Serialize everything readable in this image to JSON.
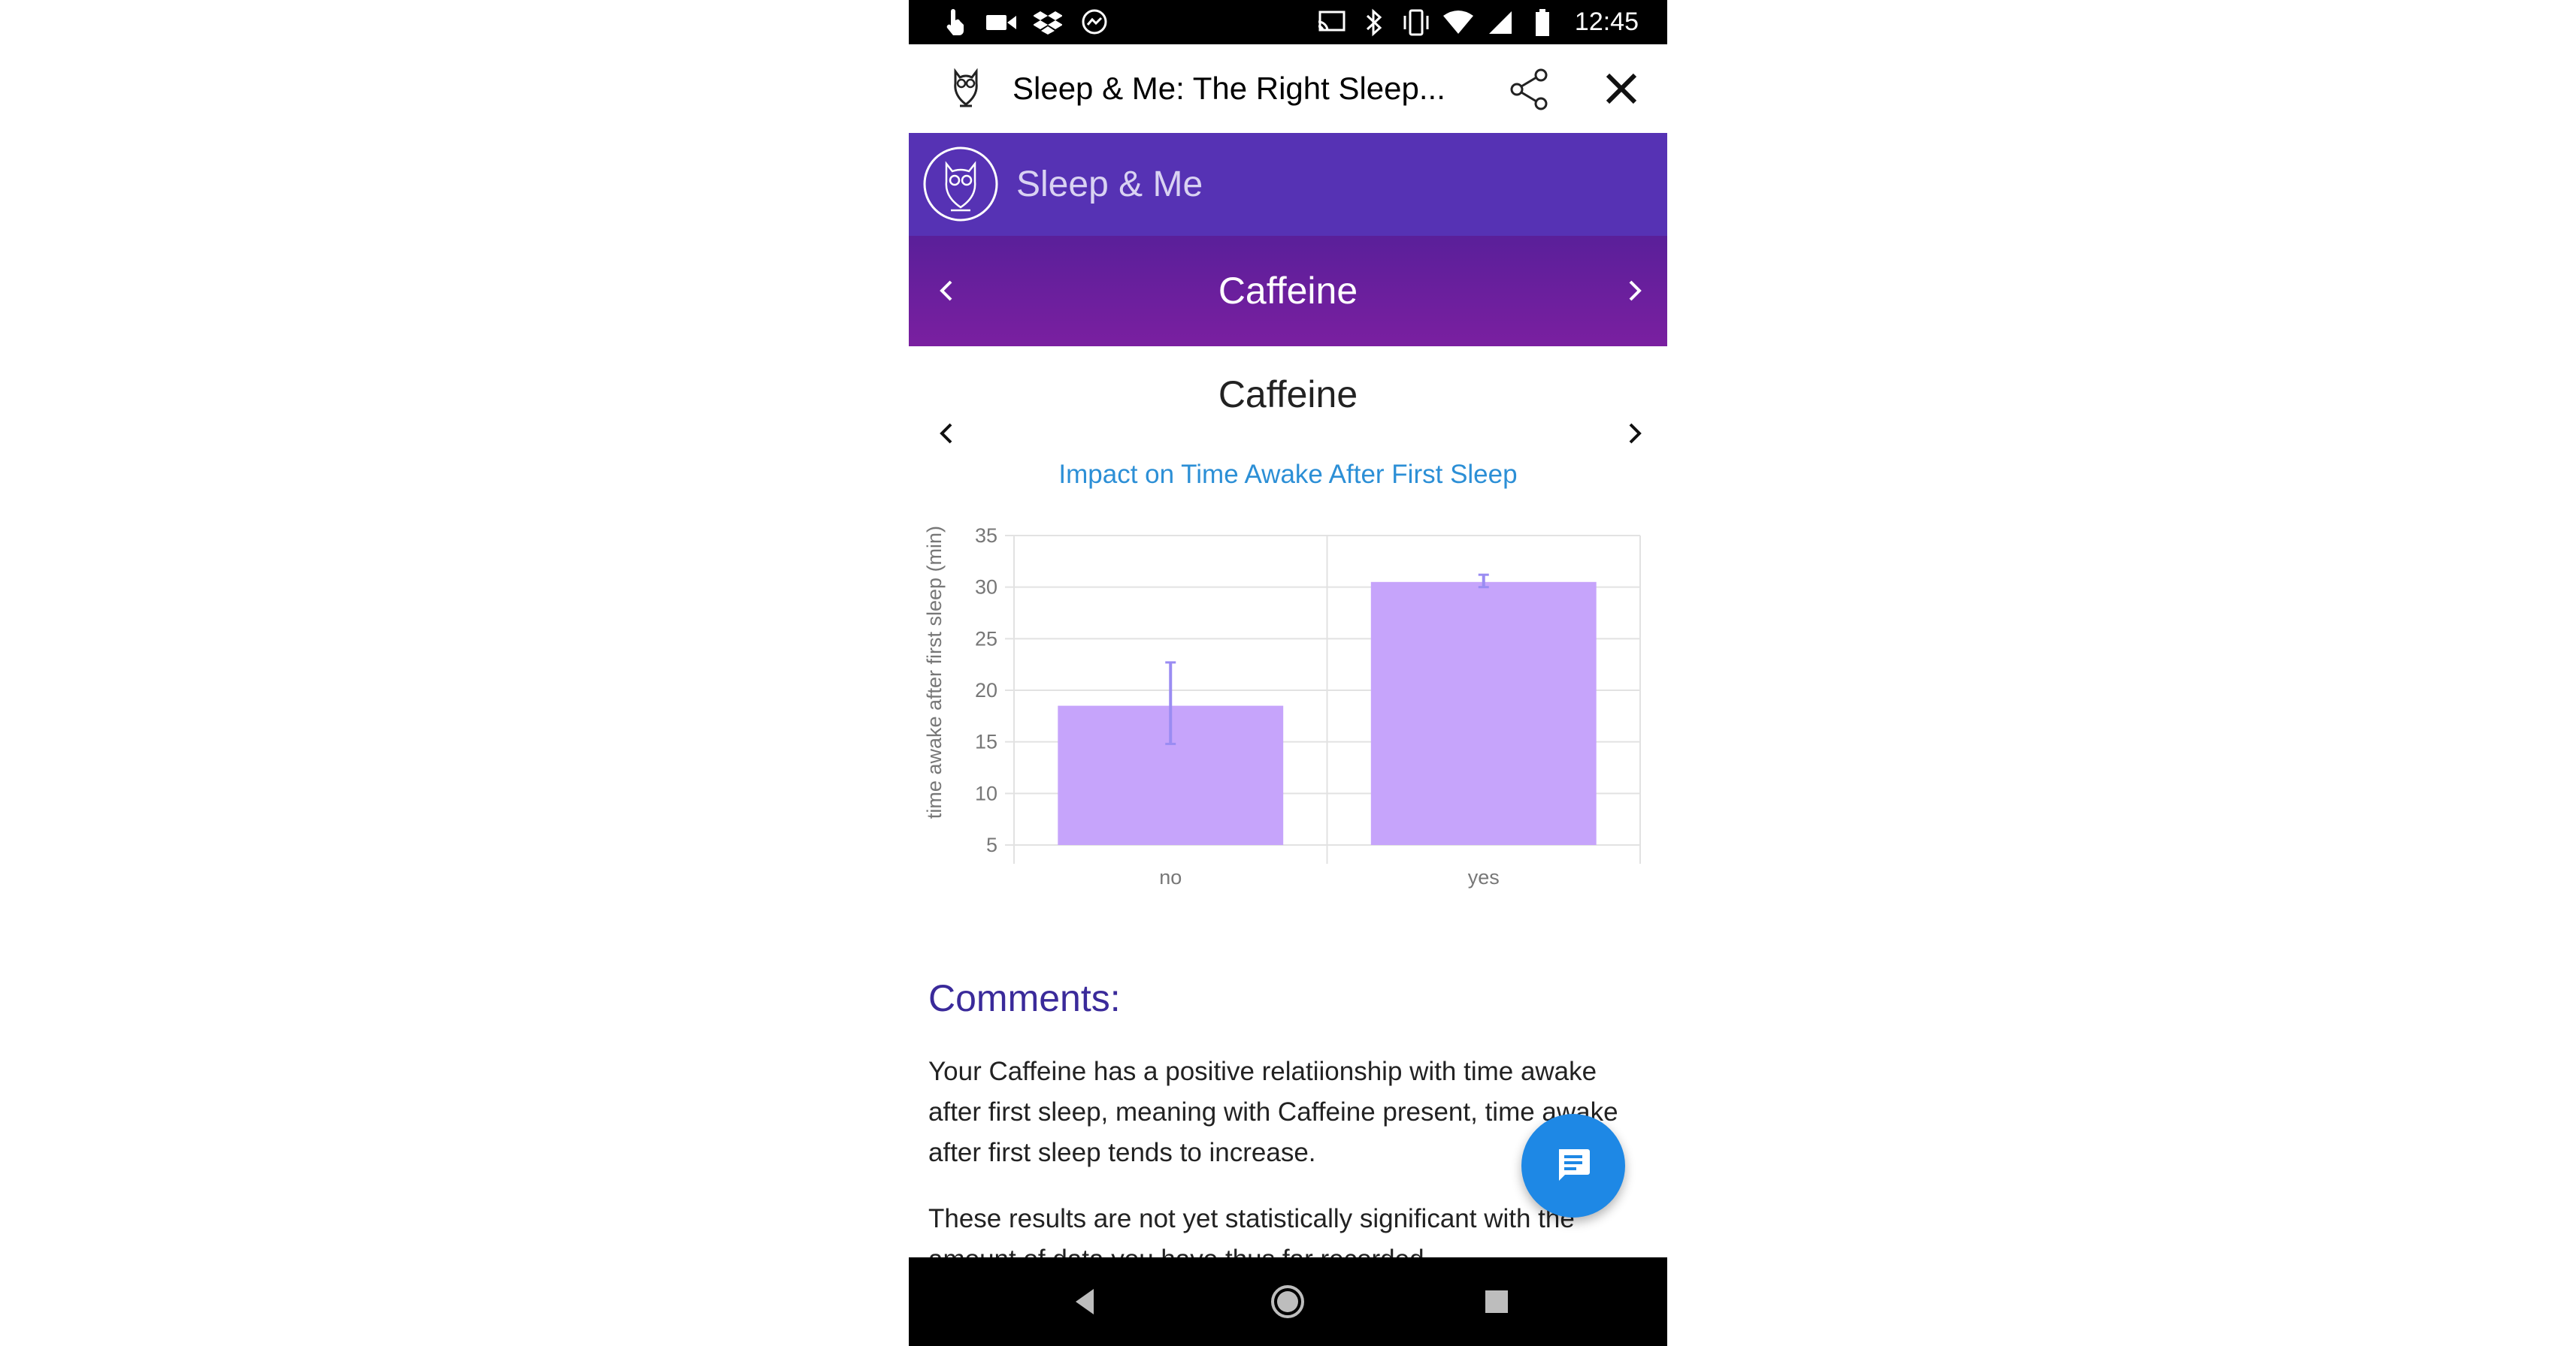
{
  "status_bar": {
    "time": "12:45",
    "left_icons": [
      "touch-icon",
      "video-icon",
      "dropbox-icon",
      "messenger-icon"
    ],
    "right_icons": [
      "cast-icon",
      "bluetooth-icon",
      "vibrate-icon",
      "wifi-icon",
      "signal-icon",
      "battery-icon"
    ]
  },
  "header": {
    "title": "Sleep & Me: The Right Sleep...",
    "share_icon": "share-icon",
    "close_icon": "close-icon"
  },
  "brand": {
    "name": "Sleep & Me"
  },
  "category": {
    "title": "Caffeine"
  },
  "content": {
    "title": "Caffeine",
    "subtitle": "Impact on Time Awake After First Sleep"
  },
  "chart_data": {
    "type": "bar",
    "title": "Impact on Time Awake After First Sleep",
    "xlabel": "",
    "ylabel": "time awake after first sleep (min)",
    "categories": [
      "no",
      "yes"
    ],
    "values": [
      18.5,
      30.5
    ],
    "error_low": [
      14.8,
      30.0
    ],
    "error_high": [
      22.7,
      31.2
    ],
    "ylim": [
      5,
      35
    ],
    "yticks": [
      5,
      10,
      15,
      20,
      25,
      30,
      35
    ],
    "grid": true,
    "colors": {
      "bar": "#c6a4fb",
      "error": "#9a8cf2",
      "grid": "#e2e2e2",
      "text": "#777777"
    }
  },
  "comments": {
    "title": "Comments:",
    "p1": "Your Caffeine has a positive relatiionship with time awake after first sleep, meaning with Caffeine present, time awake after first sleep tends to increase.",
    "p2": "These results are not yet statistically significant with the amount of data you have thus far recorded."
  },
  "fab": {
    "icon": "chat-icon"
  },
  "nav": {
    "icons": [
      "back-icon",
      "home-icon",
      "recents-icon"
    ]
  },
  "colors": {
    "brand_bar": "#5632b4",
    "category_bar": "#6a1fa0",
    "subtitle": "#2c8fd6",
    "comments_title": "#3a2a9a",
    "fab": "#1e88e5"
  }
}
